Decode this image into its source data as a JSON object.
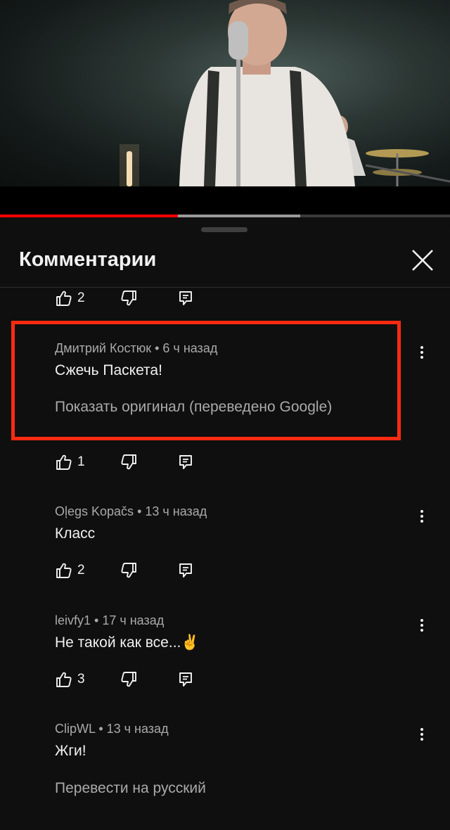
{
  "sheet": {
    "title": "Комментарии",
    "close_icon": "close-icon"
  },
  "player": {
    "progress_played": 0.395,
    "progress_buffered": 0.667
  },
  "comments": [
    {
      "author": "",
      "likes": "2"
    },
    {
      "author": "Дмитрий Костюк",
      "time": "6 ч назад",
      "text": "Сжечь Паскета!",
      "translation_note": "Показать оригинал (переведено Google)",
      "likes": "1",
      "highlighted": true,
      "highlight_color": "#ff2a12"
    },
    {
      "author": "Oļegs Kopačs",
      "time": "13 ч назад",
      "text": "Класс",
      "likes": "2"
    },
    {
      "author": "leivfy1",
      "time": "17 ч назад",
      "text": "Не такой как все...",
      "emoji": "✌️",
      "likes": "3"
    },
    {
      "author": "ClipWL",
      "time": "13 ч назад",
      "text": "Жги!",
      "translate_link": "Перевести на русский"
    }
  ],
  "separator": " • ",
  "colors": {
    "background": "#0f0f0f",
    "text": "#f1f1f1",
    "secondary_text": "#aaaaaa",
    "progress_red": "#ff0000"
  }
}
